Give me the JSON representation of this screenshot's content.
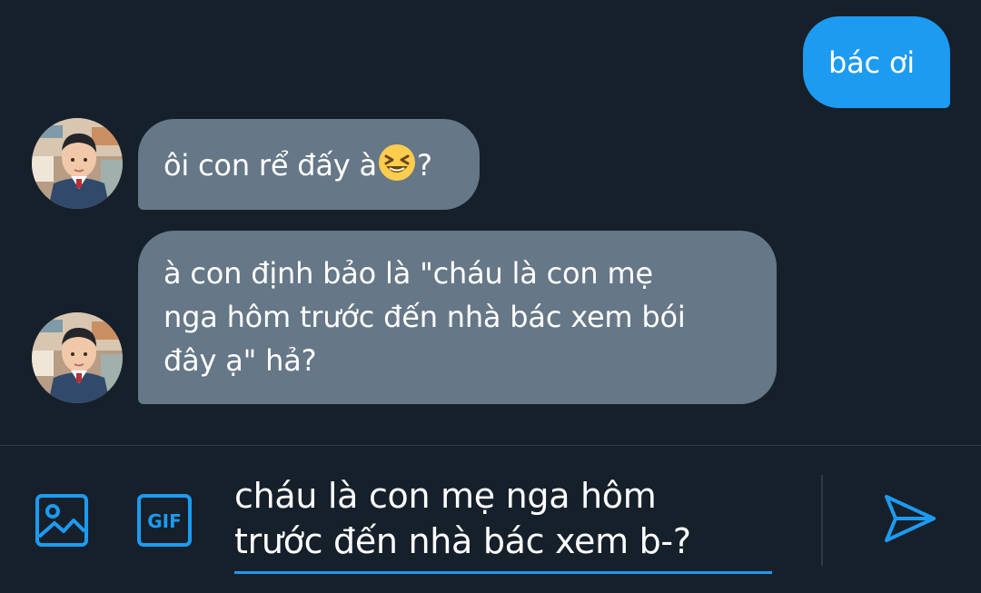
{
  "conversation": {
    "messages": [
      {
        "sender": "me",
        "text": "bác ơi"
      },
      {
        "sender": "other",
        "text": "ôi con rể đấy à",
        "emoji": "laughing-face-emoji",
        "suffix": "?"
      },
      {
        "sender": "other",
        "lines": [
          "à con định bảo là \"cháu là con mẹ",
          "nga hôm trước đến nhà bác xem bói",
          "đây ạ\" hả?"
        ]
      }
    ]
  },
  "composer": {
    "draft_lines": [
      "cháu là con mẹ nga hôm",
      "trước đến nhà bác xem b-?"
    ],
    "media_icon": "image-icon",
    "gif_icon": "gif-icon",
    "gif_label": "GIF",
    "send_icon": "send-icon"
  },
  "theme": {
    "background": "#16202b",
    "sent_bubble": "#1d9bf0",
    "received_bubble": "#667787",
    "accent": "#1d9bf0",
    "divider": "#2f3b47"
  }
}
